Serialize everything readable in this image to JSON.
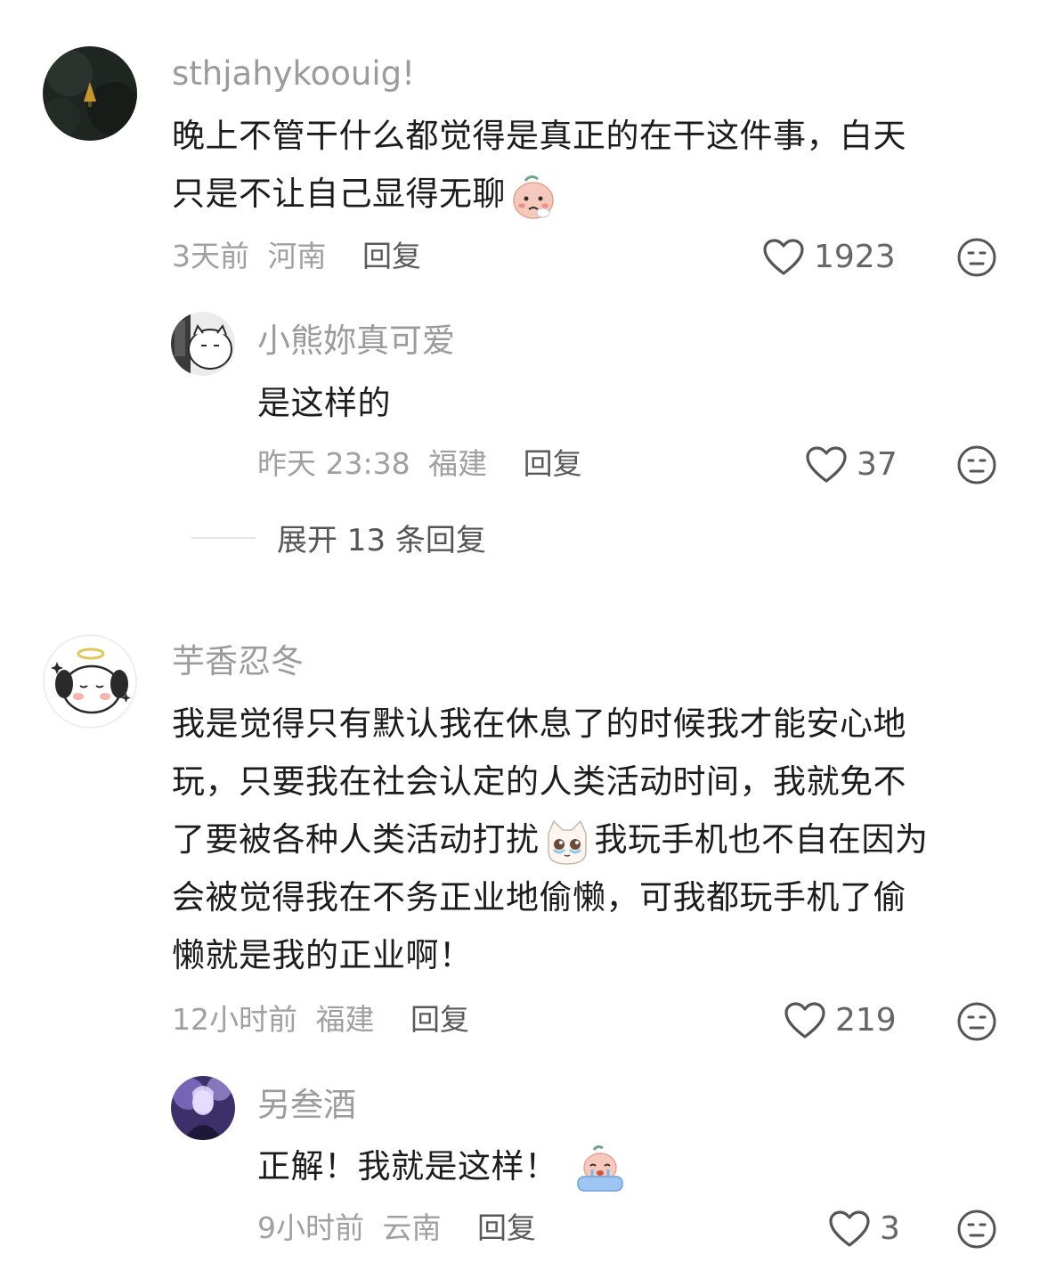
{
  "comments": [
    {
      "username": "sthjahykoouig!",
      "text_lines": [
        "晚上不管干什么都觉得是真正的在干这件事，白天",
        "只是不让自己显得无聊"
      ],
      "emoji": "crying-face-emoji",
      "time": "3天前",
      "location": "河南",
      "reply_label": "回复",
      "likes": "1923",
      "avatar_icon": "forest-tree-avatar",
      "replies": [
        {
          "username": "小熊妳真可爱",
          "text": "是这样的",
          "time": "昨天 23:38",
          "location": "福建",
          "reply_label": "回复",
          "likes": "37",
          "avatar_icon": "cartoon-cat-avatar"
        }
      ],
      "expand_label": "展开 13 条回复"
    },
    {
      "username": "芋香忍冬",
      "text_parts": [
        "我是觉得只有默认我在休息了的时候我才能安心地",
        "玩，只要我在社会认定的人类活动时间，我就免不",
        "了要被各种人类活动打扰",
        "我玩手机也不自在因为",
        "会被觉得我在不务正业地偷懒，可我都玩手机了偷",
        "懒就是我的正业啊！"
      ],
      "emoji": "teary-cat-emoji",
      "time": "12小时前",
      "location": "福建",
      "reply_label": "回复",
      "likes": "219",
      "avatar_icon": "angel-dog-avatar",
      "replies": [
        {
          "username": "另叁酒",
          "text": "正解！我就是这样！",
          "emoji": "crying-bath-emoji",
          "time": "9小时前",
          "location": "云南",
          "reply_label": "回复",
          "likes": "3",
          "avatar_icon": "purple-figure-avatar"
        }
      ]
    }
  ],
  "colors": {
    "text": "#1c1c1c",
    "username": "#9b9b9b",
    "meta": "#a0a0a0",
    "reply": "#5a5a5a",
    "icon": "#555555"
  }
}
